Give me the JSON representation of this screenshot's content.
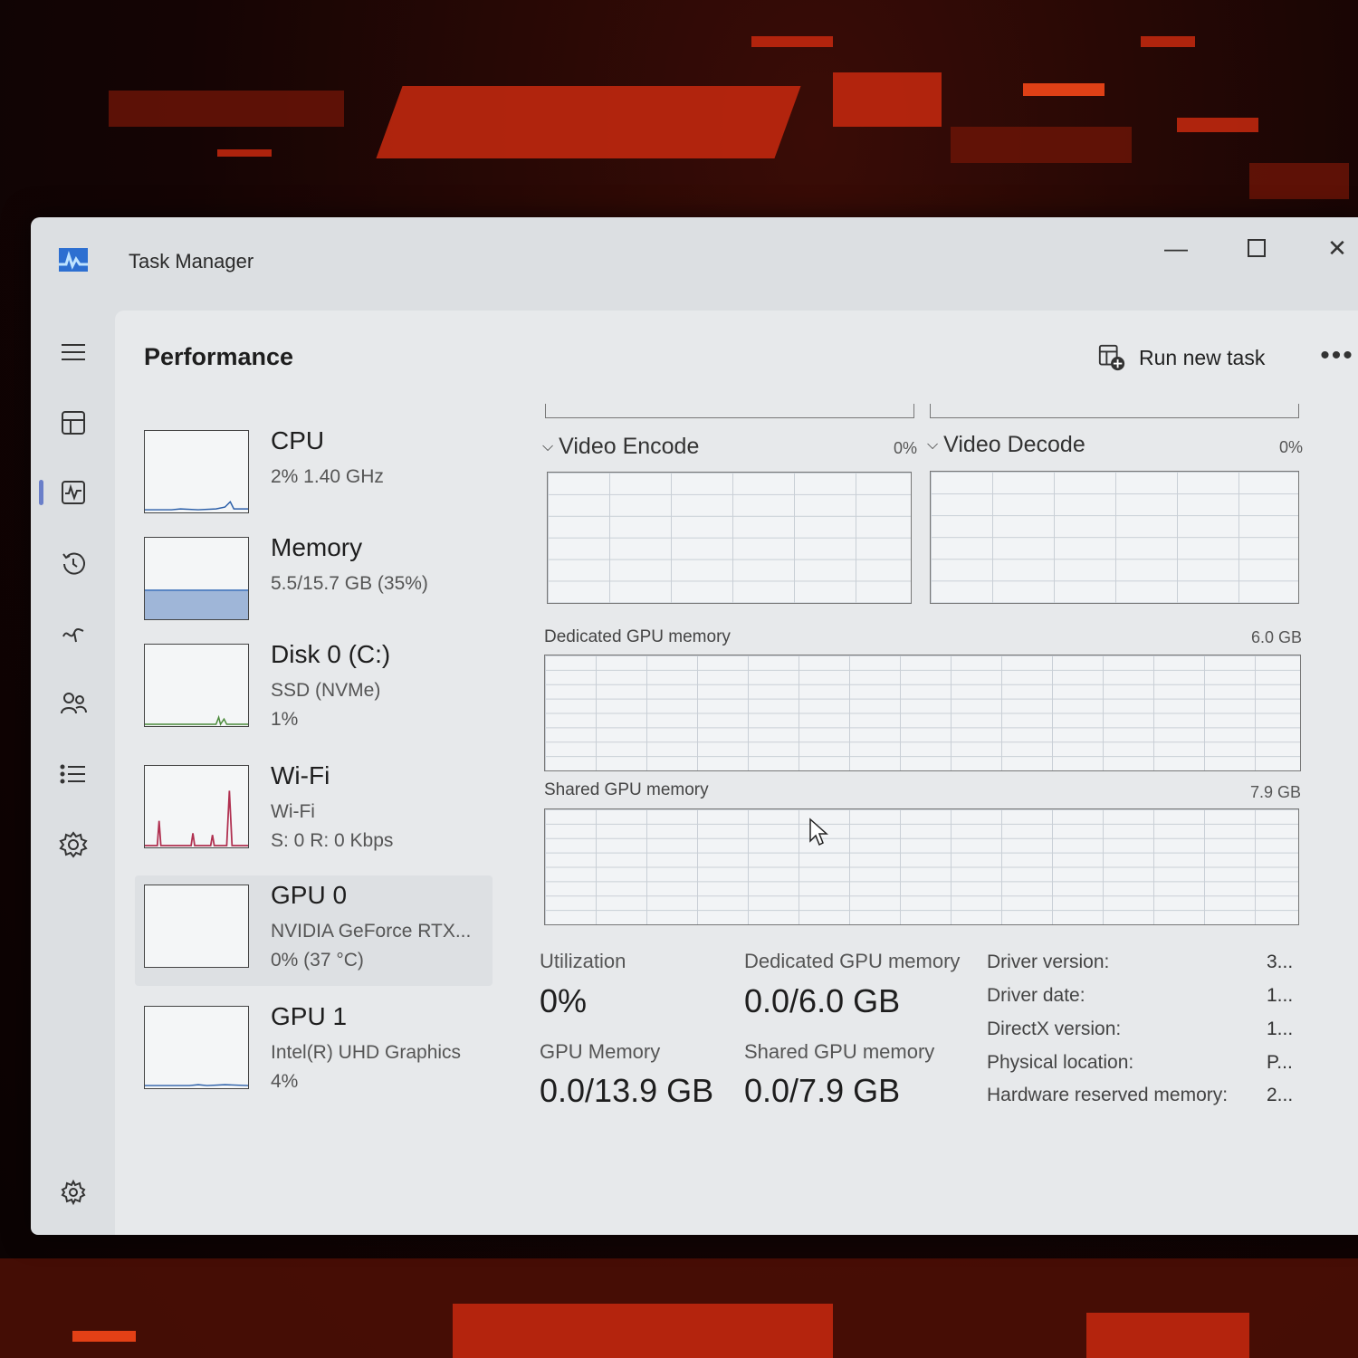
{
  "window": {
    "title": "Task Manager"
  },
  "header": {
    "page_title": "Performance",
    "run_new_task": "Run new task"
  },
  "devices": [
    {
      "name": "CPU",
      "line1": "2%  1.40 GHz",
      "line2": ""
    },
    {
      "name": "Memory",
      "line1": "5.5/15.7 GB (35%)",
      "line2": ""
    },
    {
      "name": "Disk 0 (C:)",
      "line1": "SSD (NVMe)",
      "line2": "1%"
    },
    {
      "name": "Wi-Fi",
      "line1": "Wi-Fi",
      "line2": "S: 0  R: 0 Kbps"
    },
    {
      "name": "GPU 0",
      "line1": "NVIDIA GeForce RTX...",
      "line2": "0%  (37 °C)"
    },
    {
      "name": "GPU 1",
      "line1": "Intel(R) UHD Graphics",
      "line2": "4%"
    }
  ],
  "graphs": {
    "video_encode": {
      "title": "Video Encode",
      "value": "0%"
    },
    "video_decode": {
      "title": "Video Decode",
      "value": "0%"
    },
    "dedicated": {
      "title": "Dedicated GPU memory",
      "value": "6.0 GB"
    },
    "shared": {
      "title": "Shared GPU memory",
      "value": "7.9 GB"
    }
  },
  "stats": {
    "utilization": {
      "label": "Utilization",
      "value": "0%"
    },
    "dedicated": {
      "label": "Dedicated GPU memory",
      "value": "0.0/6.0 GB"
    },
    "gpu_memory": {
      "label": "GPU Memory",
      "value": "0.0/13.9 GB"
    },
    "shared": {
      "label": "Shared GPU memory",
      "value": "0.0/7.9 GB"
    }
  },
  "info": [
    {
      "key": "Driver version:",
      "value": "3..."
    },
    {
      "key": "Driver date:",
      "value": "1..."
    },
    {
      "key": "DirectX version:",
      "value": "1..."
    },
    {
      "key": "Physical location:",
      "value": "P..."
    },
    {
      "key": "Hardware reserved memory:",
      "value": "2..."
    }
  ],
  "memory_usage_percent": 35,
  "icons": {
    "nav": [
      "hamburger-menu-icon",
      "processes-icon",
      "performance-icon",
      "app-history-icon",
      "startup-apps-icon",
      "users-icon",
      "details-icon",
      "services-icon",
      "settings-icon"
    ]
  },
  "colors": {
    "accent": "#6a7fc9",
    "memory_fill": "#9fb6d8",
    "wifi_spike": "#b03050",
    "cpu_line": "#2a5ea8"
  }
}
